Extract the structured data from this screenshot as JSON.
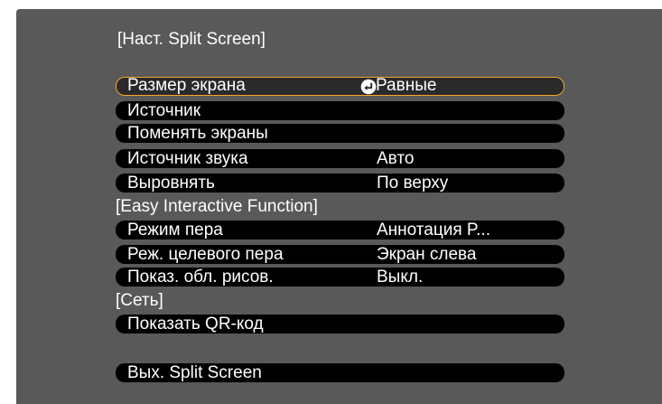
{
  "title": "[Наст. Split Screen]",
  "items": [
    {
      "label": "Размер экрана",
      "value": "Равные"
    },
    {
      "label": "Источник",
      "value": ""
    },
    {
      "label": "Поменять экраны",
      "value": ""
    },
    {
      "label": "Источник звука",
      "value": "Авто"
    },
    {
      "label": "Выровнять",
      "value": "По верху"
    }
  ],
  "section_eif": "[Easy Interactive Function]",
  "eif_items": [
    {
      "label": "Режим пера",
      "value": "Аннотация P..."
    },
    {
      "label": "Реж. целевого пера",
      "value": "Экран слева"
    },
    {
      "label": "Показ. обл. рисов.",
      "value": "Выкл."
    }
  ],
  "section_net": "[Сеть]",
  "net_items": [
    {
      "label": "Показать QR-код"
    }
  ],
  "exit_label": "Вых. Split Screen",
  "colors": {
    "background": "#595959",
    "item_bar": "#000000",
    "selection_border": "#f4a72c",
    "text": "#ffffff"
  },
  "icons": {
    "selected_item_marker": "enter-arrow-icon"
  }
}
